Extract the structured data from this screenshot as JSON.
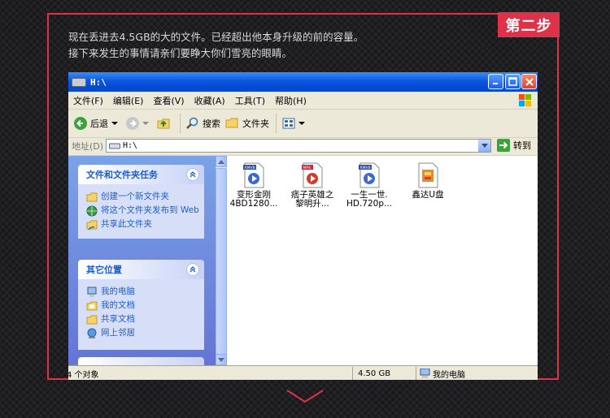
{
  "step_badge": "第二步",
  "caption": {
    "line1": "现在丢进去4.5GB的大的文件。已经超出他本身升级的前的容量。",
    "line2": "接下来发生的事情请亲们要睁大你们雪亮的眼睛。"
  },
  "window": {
    "title": "H:\\",
    "menu": [
      "文件(F)",
      "编辑(E)",
      "查看(V)",
      "收藏(A)",
      "工具(T)",
      "帮助(H)"
    ],
    "toolbar": {
      "back": "后退",
      "search": "搜索",
      "folders": "文件夹"
    },
    "address": {
      "label": "地址(D)",
      "value": "H:\\",
      "go": "转到"
    },
    "task_panel": {
      "title": "文件和文件夹任务",
      "items": [
        "创建一个新文件夹",
        "将这个文件夹发布到 Web",
        "共享此文件夹"
      ]
    },
    "places_panel": {
      "title": "其它位置",
      "items": [
        "我的电脑",
        "我的文档",
        "共享文档",
        "网上邻居"
      ]
    },
    "files": [
      {
        "name_line1": "变形金刚",
        "name_line2": "4BD1280...",
        "icon": "rmvb-video-icon",
        "badge": "RMVB"
      },
      {
        "name_line1": "痞子英雄之",
        "name_line2": "黎明升...",
        "icon": "media-player-icon",
        "badge": "MP4"
      },
      {
        "name_line1": "一生一世.",
        "name_line2": "HD.720p...",
        "icon": "rmvb-video-icon",
        "badge": "RMVB"
      },
      {
        "name_line1": "鑫达U盘",
        "name_line2": "",
        "icon": "drive-app-icon",
        "badge": ""
      }
    ],
    "status": {
      "objects": "4 个对象",
      "size": "4.50 GB",
      "location": "我的电脑"
    }
  },
  "colors": {
    "accent": "#e0314a",
    "xp_blue": "#0a58e0",
    "link": "#215dc6"
  }
}
